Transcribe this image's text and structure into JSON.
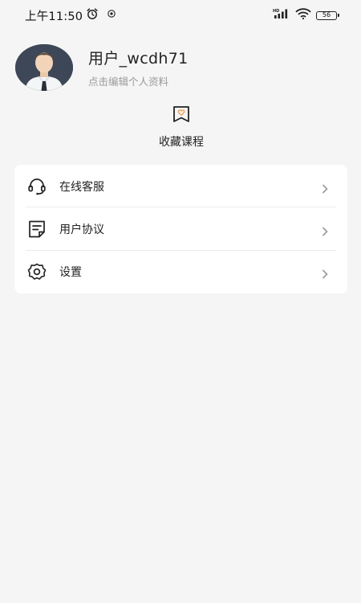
{
  "status_bar": {
    "time": "上午11:50",
    "battery": "56",
    "icons": [
      "alarm-icon",
      "eye-icon",
      "hd-signal-icon",
      "wifi-icon",
      "battery-icon"
    ]
  },
  "profile": {
    "username": "用户_wcdh71",
    "edit_hint": "点击编辑个人资料"
  },
  "favorites": {
    "label": "收藏课程",
    "icon": "bookmark-heart-icon",
    "accent": "#f0a35a"
  },
  "menu": {
    "items": [
      {
        "label": "在线客服",
        "icon": "headset-icon"
      },
      {
        "label": "用户协议",
        "icon": "document-icon"
      },
      {
        "label": "设置",
        "icon": "gear-icon"
      }
    ]
  }
}
